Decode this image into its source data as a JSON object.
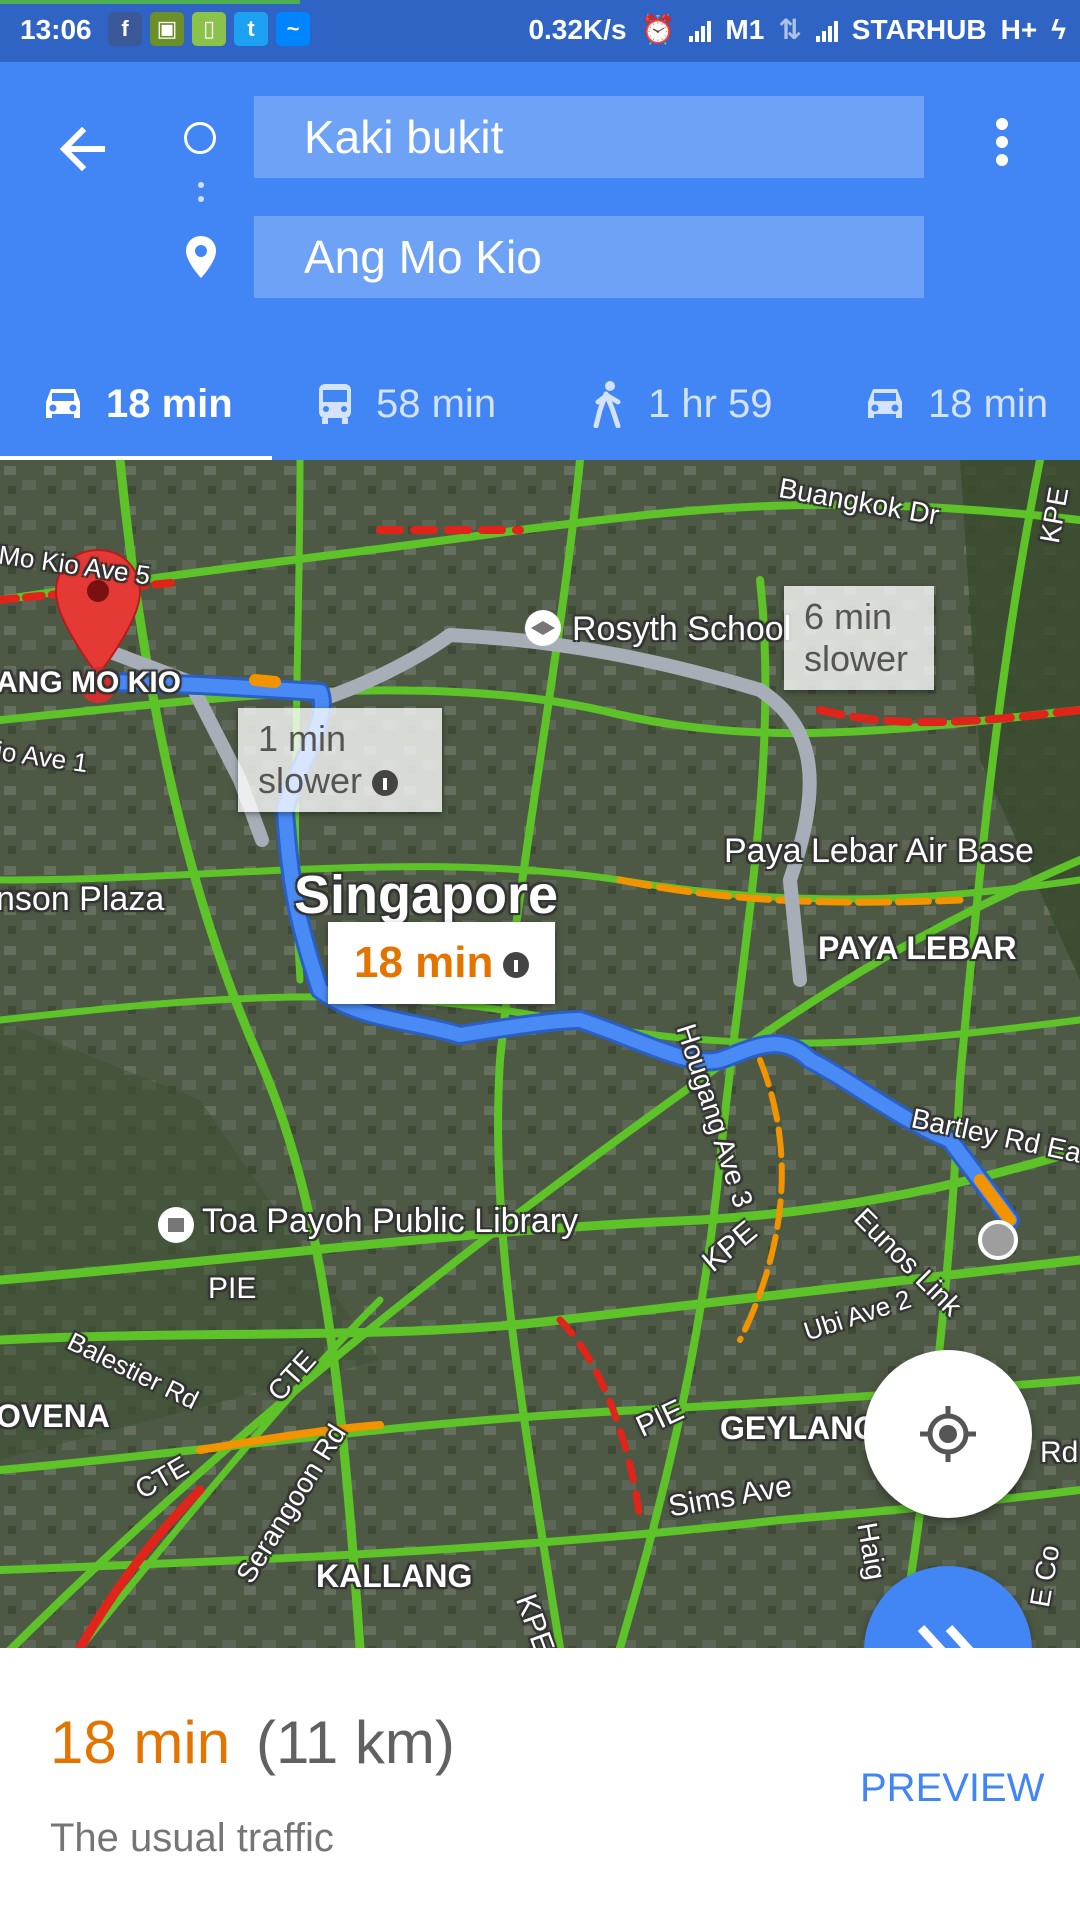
{
  "status_bar": {
    "time": "13:06",
    "speed": "0.32K/s",
    "carrier1": "M1",
    "carrier2": "STARHUB",
    "network": "H+",
    "notif_icons": [
      "facebook-icon",
      "android-icon",
      "battery-app-icon",
      "twitter-icon",
      "messenger-icon"
    ]
  },
  "search": {
    "origin": "Kaki bukit",
    "destination": "Ang Mo Kio"
  },
  "modes": [
    {
      "mode": "car-icon",
      "label": "18 min",
      "active": true
    },
    {
      "mode": "transit-icon",
      "label": "58 min",
      "active": false
    },
    {
      "mode": "walk-icon",
      "label": "1 hr 59",
      "active": false
    },
    {
      "mode": "taxi-icon",
      "label": "18 min",
      "active": false
    }
  ],
  "map": {
    "labels": {
      "buangkok": "Buangkok Dr",
      "amk_ave5": "Mo Kio Ave 5",
      "amk": "ANG MO KIO",
      "amk_ave1": "io Ave 1",
      "rosyth": "Rosyth School",
      "paya_lebar_air": "Paya Lebar Air Base",
      "paya_lebar": "PAYA LEBAR",
      "singapore": "Singapore",
      "junction": "nson Plaza",
      "hougang": "Hougang Ave 3",
      "bartley": "Bartley Rd Ea",
      "eunos": "Eunos Link",
      "ubi": "Ubi Ave 2",
      "toa_payoh": "Toa Payoh Public Library",
      "pie1": "PIE",
      "pie2": "PIE",
      "kpe1": "KPE",
      "kpe2": "KPE",
      "kpe3": "KPE",
      "cte1": "CTE",
      "cte2": "CTE",
      "balestier": "Balestier Rd",
      "novena": "OVENA",
      "serangoon": "Serangoon Rd",
      "kallang": "KALLANG",
      "geylang": "GEYLANG",
      "sims": "Sims Ave",
      "haig": "Haig",
      "rd": "Rd",
      "ec": "E Co"
    },
    "callouts": {
      "alt1_line1": "1 min",
      "alt1_line2": "slower",
      "alt2_line1": "6 min",
      "alt2_line2": "slower",
      "main": "18 min"
    }
  },
  "summary": {
    "duration": "18 min",
    "distance": "(11 km)",
    "traffic": "The usual traffic",
    "preview": "PREVIEW"
  },
  "colors": {
    "primary": "#4285f4",
    "route": "#4a8af4",
    "traffic_green": "#5ec229",
    "traffic_orange": "#f29400",
    "traffic_red": "#e0241a",
    "duration": "#e37400"
  }
}
